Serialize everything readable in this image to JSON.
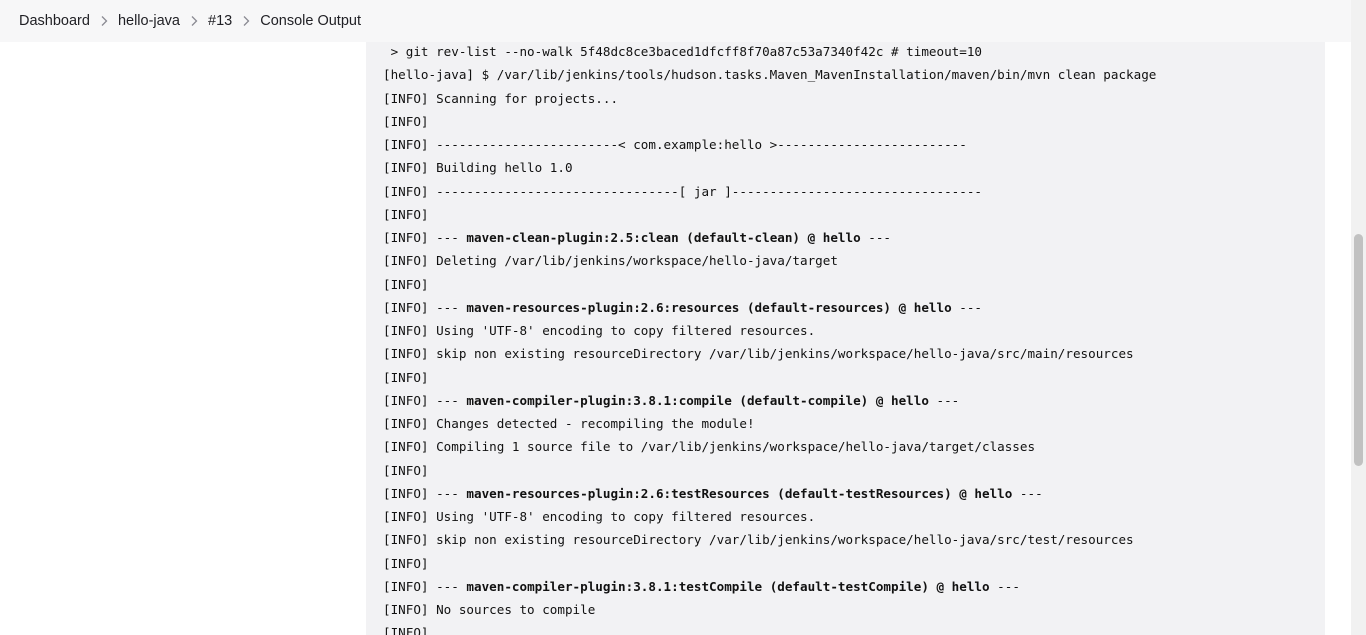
{
  "breadcrumb": {
    "items": [
      "Dashboard",
      "hello-java",
      "#13",
      "Console Output"
    ]
  },
  "console": {
    "lines": [
      {
        "text": " > git rev-list --no-walk 5f48dc8ce3baced1dfcff8f70a87c53a7340f42c # timeout=10"
      },
      {
        "text": "[hello-java] $ /var/lib/jenkins/tools/hudson.tasks.Maven_MavenInstallation/maven/bin/mvn clean package"
      },
      {
        "text": "[INFO] Scanning for projects..."
      },
      {
        "text": "[INFO]"
      },
      {
        "text": "[INFO] ------------------------< com.example:hello >-------------------------"
      },
      {
        "text": "[INFO] Building hello 1.0"
      },
      {
        "text": "[INFO] --------------------------------[ jar ]---------------------------------"
      },
      {
        "text": "[INFO]"
      },
      {
        "prefix": "[INFO] --- ",
        "bold": "maven-clean-plugin:2.5:clean (default-clean) @ hello",
        "suffix": " ---"
      },
      {
        "text": "[INFO] Deleting /var/lib/jenkins/workspace/hello-java/target"
      },
      {
        "text": "[INFO]"
      },
      {
        "prefix": "[INFO] --- ",
        "bold": "maven-resources-plugin:2.6:resources (default-resources) @ hello",
        "suffix": " ---"
      },
      {
        "text": "[INFO] Using 'UTF-8' encoding to copy filtered resources."
      },
      {
        "text": "[INFO] skip non existing resourceDirectory /var/lib/jenkins/workspace/hello-java/src/main/resources"
      },
      {
        "text": "[INFO]"
      },
      {
        "prefix": "[INFO] --- ",
        "bold": "maven-compiler-plugin:3.8.1:compile (default-compile) @ hello",
        "suffix": " ---"
      },
      {
        "text": "[INFO] Changes detected - recompiling the module!"
      },
      {
        "text": "[INFO] Compiling 1 source file to /var/lib/jenkins/workspace/hello-java/target/classes"
      },
      {
        "text": "[INFO]"
      },
      {
        "prefix": "[INFO] --- ",
        "bold": "maven-resources-plugin:2.6:testResources (default-testResources) @ hello",
        "suffix": " ---"
      },
      {
        "text": "[INFO] Using 'UTF-8' encoding to copy filtered resources."
      },
      {
        "text": "[INFO] skip non existing resourceDirectory /var/lib/jenkins/workspace/hello-java/src/test/resources"
      },
      {
        "text": "[INFO]"
      },
      {
        "prefix": "[INFO] --- ",
        "bold": "maven-compiler-plugin:3.8.1:testCompile (default-testCompile) @ hello",
        "suffix": " ---"
      },
      {
        "text": "[INFO] No sources to compile"
      },
      {
        "text": "[INFO]"
      }
    ]
  }
}
